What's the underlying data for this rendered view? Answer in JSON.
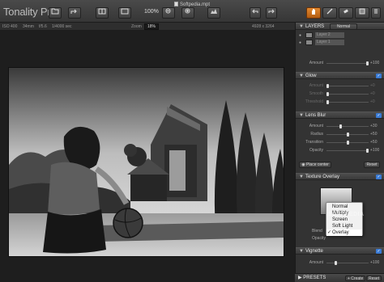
{
  "window": {
    "title": "Softpedia.mpt",
    "app_name": "Tonality Pro"
  },
  "toolbar": {
    "zoom": "100%"
  },
  "info": {
    "iso": "ISO 400",
    "focal": "34mm",
    "aperture": "f/5.6",
    "shutter": "1/4000 sec",
    "zoom_label": "Zoom",
    "zoom_value": "18%",
    "dimensions": "4928 x 3264"
  },
  "panel": {
    "layers": {
      "title": "LAYERS",
      "blend_mode": "Normal",
      "items": [
        {
          "name": "Layer 2"
        },
        {
          "name": "Layer 1"
        }
      ]
    },
    "amount_top": {
      "label": "Amount",
      "value": "+100"
    },
    "glow": {
      "title": "Glow",
      "sliders": [
        {
          "label": "Amount",
          "value": "+0"
        },
        {
          "label": "Smooth",
          "value": "+0"
        },
        {
          "label": "Threshold",
          "value": "+0"
        }
      ]
    },
    "lens_blur": {
      "title": "Lens Blur",
      "sliders": [
        {
          "label": "Amount",
          "value": "+30"
        },
        {
          "label": "Radius",
          "value": "+50"
        },
        {
          "label": "Transition",
          "value": "+50"
        },
        {
          "label": "Opacity",
          "value": "+100"
        }
      ],
      "place_center": "Place center",
      "reset": "Reset"
    },
    "texture_overlay": {
      "title": "Texture Overlay",
      "blend_options": [
        "Normal",
        "Multiply",
        "Screen",
        "Soft Light",
        "Overlay"
      ],
      "selected": "Overlay",
      "blend_label": "Blend",
      "opacity_label": "Opacity"
    },
    "vignette": {
      "title": "Vignette",
      "sliders": [
        {
          "label": "Amount",
          "value": "+100"
        }
      ]
    },
    "presets": {
      "title": "PRESETS",
      "create": "+ Create",
      "reset": "Reset"
    }
  },
  "watermark": "SOFTPEDIA",
  "colors": {
    "accent": "#e07a20",
    "check": "#3a7bd5",
    "panel": "#333333"
  }
}
